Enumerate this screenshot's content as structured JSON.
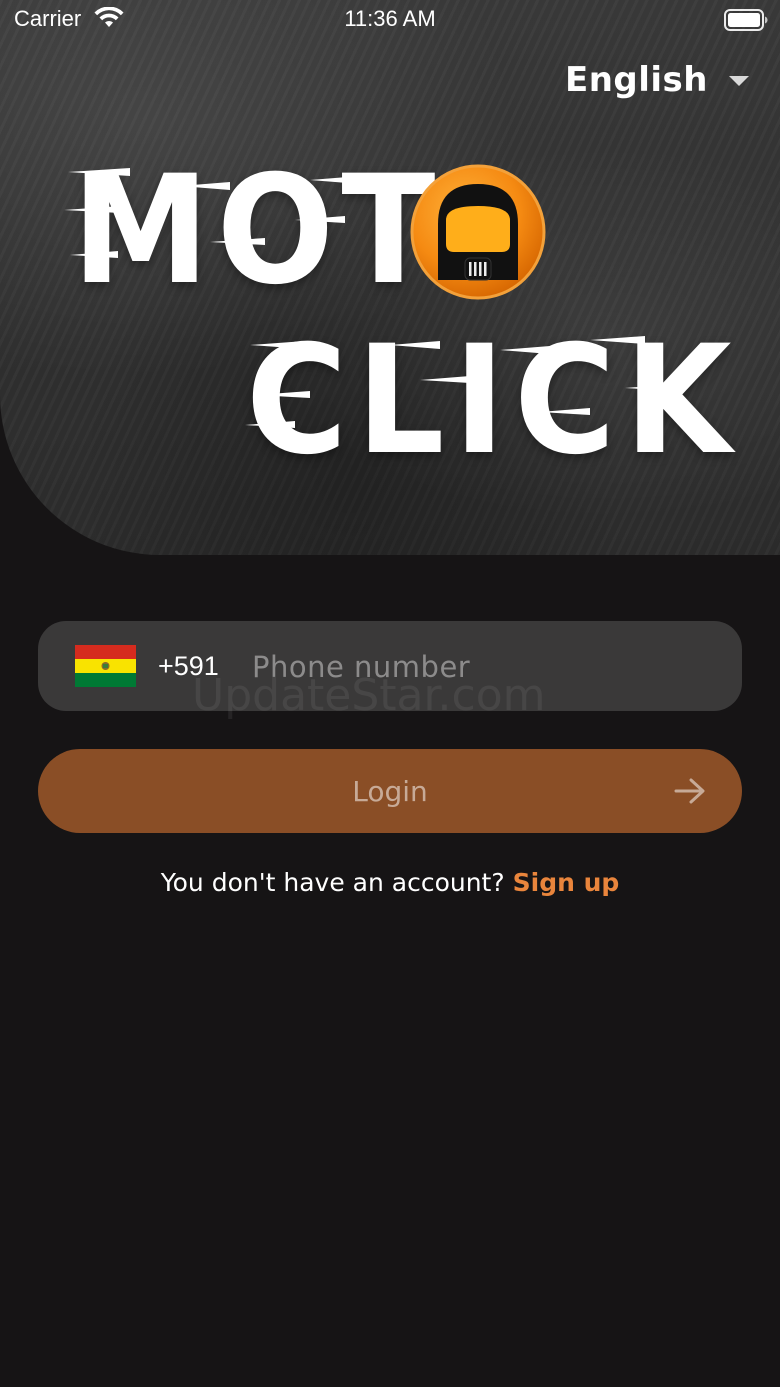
{
  "status_bar": {
    "carrier": "Carrier",
    "time": "11:36 AM",
    "wifi_icon": "wifi-icon",
    "battery_icon": "battery-icon"
  },
  "language": {
    "selected": "English",
    "icon": "caret-down-icon"
  },
  "logo": {
    "line1": "MOT",
    "line2": "CLICK",
    "icon": "helmet-icon",
    "accent_color": "#f07d10"
  },
  "form": {
    "country_flag": "bolivia-flag-icon",
    "dial_code": "+591",
    "phone_placeholder": "Phone number",
    "phone_value": "",
    "login_label": "Login",
    "login_icon": "arrow-right-icon",
    "login_color": "#8a4e26"
  },
  "signup": {
    "prompt": "You don't have an account?",
    "link_label": "Sign up",
    "link_color": "#e9853c"
  },
  "watermark": "UpdateStar.com",
  "colors": {
    "background": "#161415",
    "field_background": "#3a3939"
  }
}
